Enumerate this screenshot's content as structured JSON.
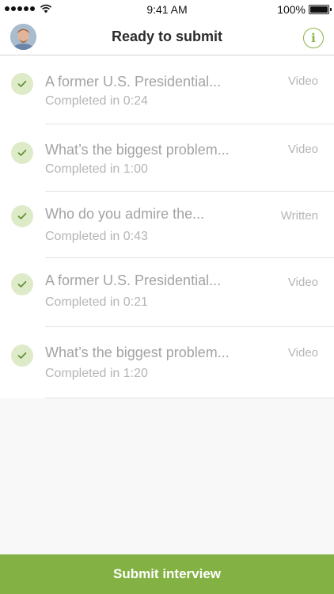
{
  "status_bar": {
    "time": "9:41 AM",
    "battery": "100%"
  },
  "header": {
    "title": "Ready to submit",
    "info_icon_glyph": "i"
  },
  "questions": [
    {
      "title": "A former U.S. Presidential...",
      "status": "Completed in 0:24",
      "type": "Video"
    },
    {
      "title": "What’s the biggest problem...",
      "status": "Completed in 1:00",
      "type": "Video"
    },
    {
      "title": "Who do you admire the...",
      "status": "Completed in 0:43",
      "type": "Written"
    },
    {
      "title": "A former U.S. Presidential...",
      "status": "Completed in 0:21",
      "type": "Video"
    },
    {
      "title": "What’s the biggest problem...",
      "status": "Completed in 1:20",
      "type": "Video"
    }
  ],
  "footer": {
    "submit_label": "Submit interview"
  },
  "colors": {
    "accent": "#84b143",
    "check_bg": "#deebc9",
    "muted_text": "#a3a3a3"
  }
}
